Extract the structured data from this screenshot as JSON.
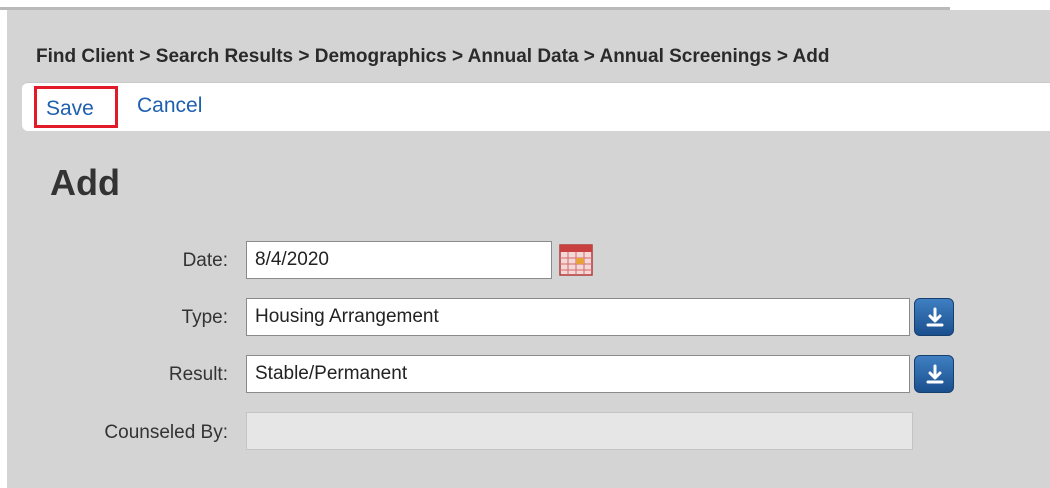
{
  "breadcrumb": {
    "text": "Find Client > Search Results > Demographics > Annual Data > Annual Screenings > Add"
  },
  "actions": {
    "save_label": "Save",
    "cancel_label": "Cancel"
  },
  "page": {
    "title": "Add"
  },
  "form": {
    "date": {
      "label": "Date:",
      "value": "8/4/2020",
      "icon": "calendar-icon"
    },
    "type": {
      "label": "Type:",
      "value": "Housing Arrangement",
      "icon": "dropdown-arrow-icon"
    },
    "result": {
      "label": "Result:",
      "value": "Stable/Permanent",
      "icon": "dropdown-arrow-icon"
    },
    "counseled_by": {
      "label": "Counseled By:",
      "value": ""
    }
  },
  "colors": {
    "panel_background": "#d4d4d4",
    "link": "#1f5fb0",
    "save_highlight": "#e21b2b",
    "dropdown_button": "#2a64a8"
  }
}
